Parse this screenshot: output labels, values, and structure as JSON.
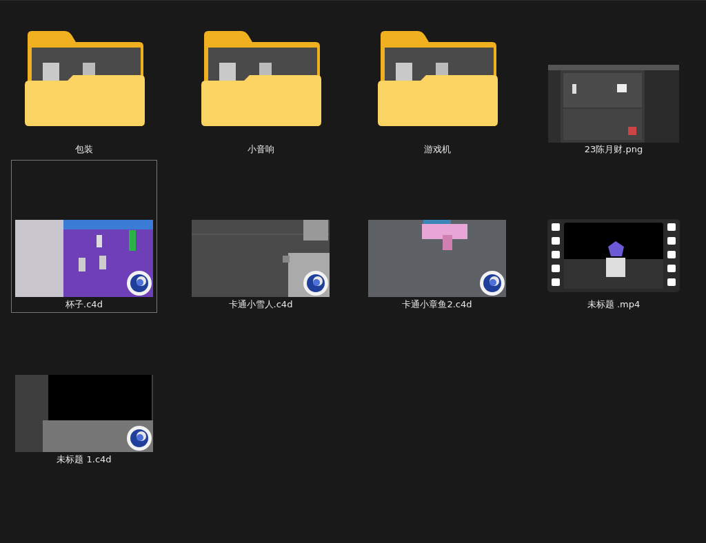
{
  "items": [
    {
      "kind": "folder",
      "name": "包装",
      "selected": false
    },
    {
      "kind": "folder",
      "name": "小音响",
      "selected": false
    },
    {
      "kind": "folder",
      "name": "游戏机",
      "selected": false
    },
    {
      "name": "23陈月财.png",
      "selected": false
    },
    {
      "kind": "c4d",
      "name": "杯子.c4d",
      "selected": true
    },
    {
      "kind": "c4d",
      "name": "卡通小雪人.c4d",
      "selected": false
    },
    {
      "kind": "c4d",
      "name": "卡通小章鱼2.c4d",
      "selected": false
    },
    {
      "kind": "video",
      "name": "未标题 .mp4",
      "selected": false
    },
    {
      "kind": "c4d",
      "name": "未标题 1.c4d",
      "selected": false
    }
  ]
}
